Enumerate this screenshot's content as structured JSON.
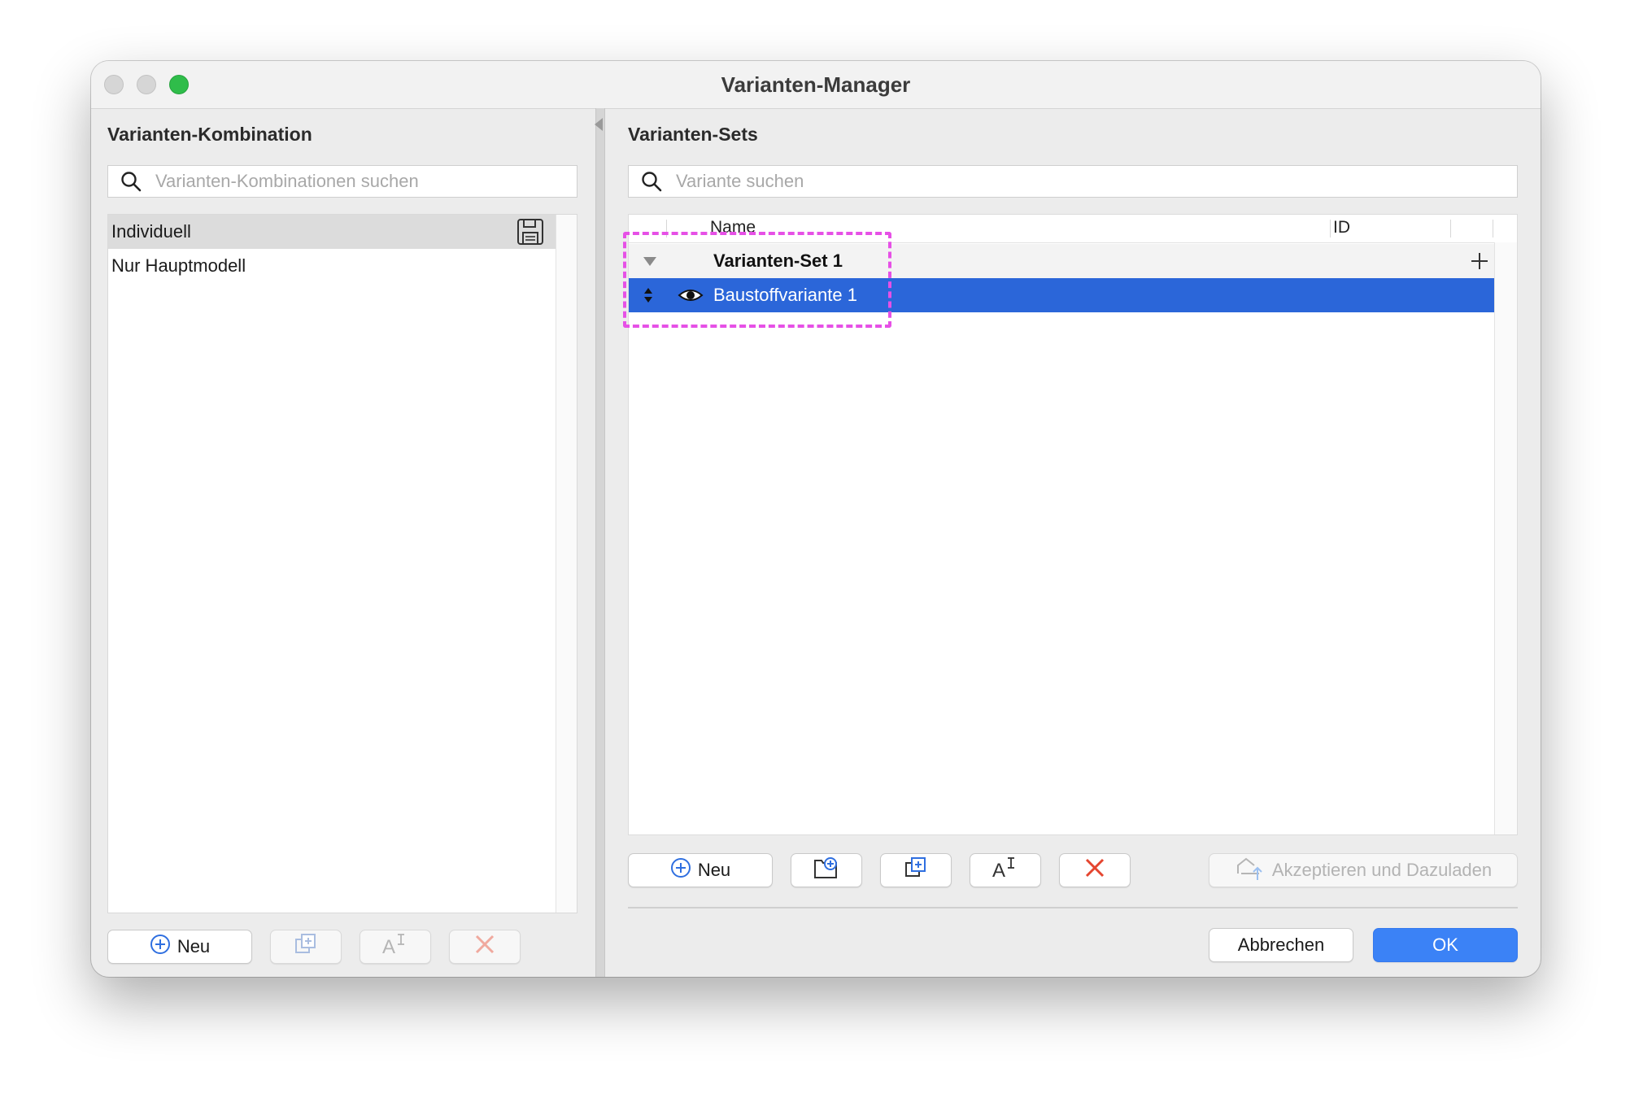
{
  "window": {
    "title": "Varianten-Manager"
  },
  "left": {
    "heading": "Varianten-Kombination",
    "search_placeholder": "Varianten-Kombinationen suchen",
    "items": [
      {
        "label": "Individuell",
        "selected": true
      },
      {
        "label": "Nur Hauptmodell",
        "selected": false
      }
    ],
    "buttons": {
      "new_label": "Neu"
    }
  },
  "right": {
    "heading": "Varianten-Sets",
    "search_placeholder": "Variante suchen",
    "columns": {
      "name": "Name",
      "id": "ID"
    },
    "group": {
      "label": "Varianten-Set 1",
      "expanded": true
    },
    "variant": {
      "label": "Baustoffvariante 1",
      "selected": true,
      "visible": true
    },
    "buttons": {
      "new_label": "Neu",
      "accept_label": "Akzeptieren und Dazuladen",
      "cancel_label": "Abbrechen",
      "ok_label": "OK"
    }
  },
  "colors": {
    "selection": "#2b66d9",
    "primary_button": "#3b82f6",
    "delete_icon": "#e5452f",
    "highlight": "#e650e6",
    "zoom_button": "#2fbd4a"
  },
  "icons": [
    "search-icon",
    "save-icon",
    "plus-circle-icon",
    "duplicate-icon",
    "rename-icon",
    "delete-icon",
    "folder-plus-icon",
    "disclosure-triangle-icon",
    "reorder-icon",
    "eye-icon",
    "add-icon",
    "cloud-upload-icon"
  ]
}
